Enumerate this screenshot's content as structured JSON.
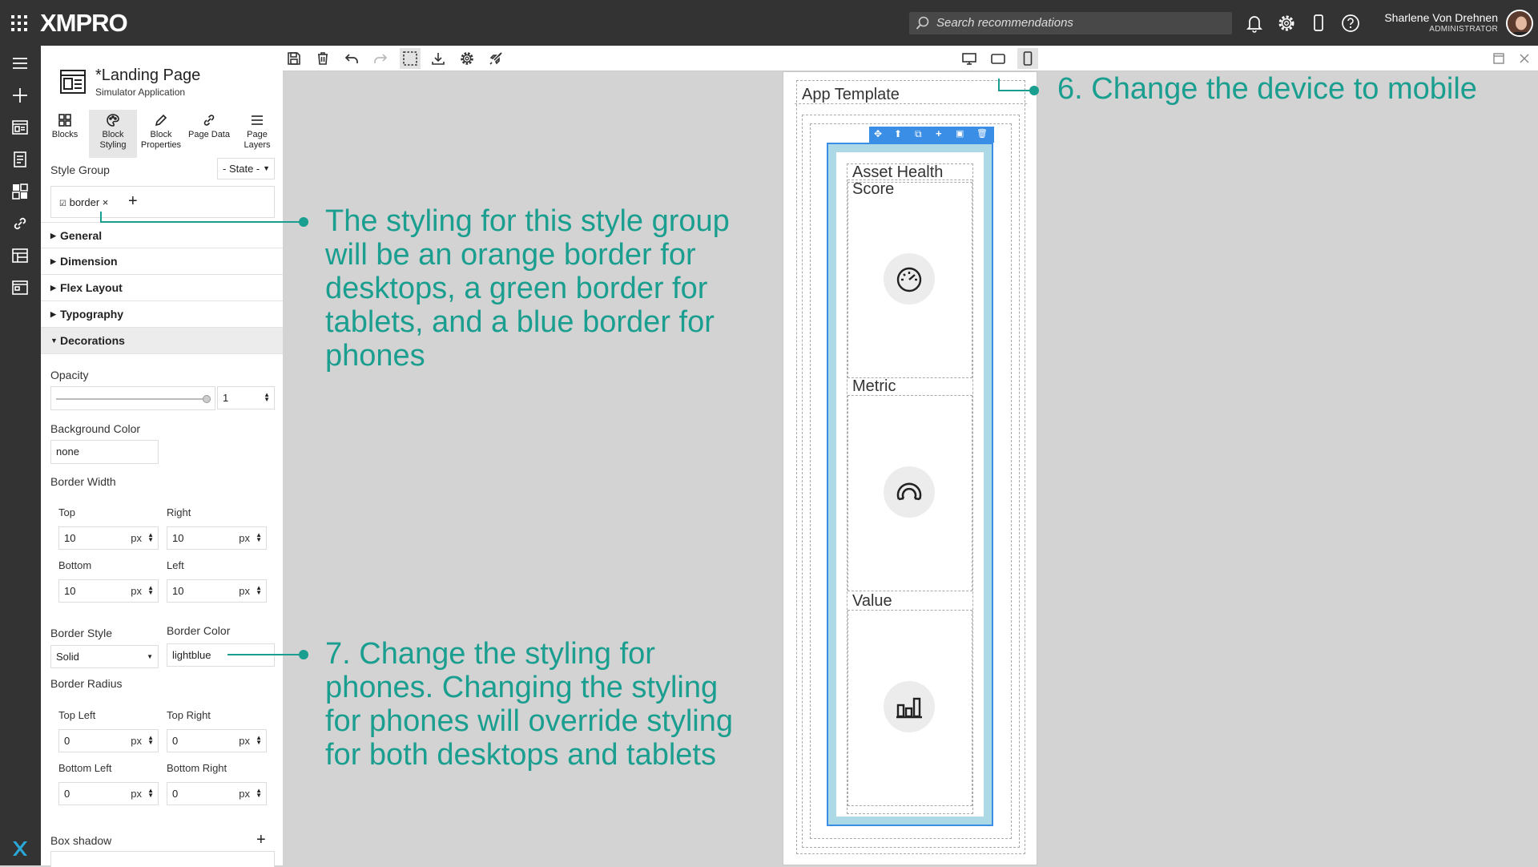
{
  "app": {
    "logo": "XMPRO",
    "search_placeholder": "Search recommendations",
    "user_name": "Sharlene Von Drehnen",
    "user_role": "ADMINISTRATOR"
  },
  "page": {
    "title": "*Landing Page",
    "subtitle": "Simulator Application"
  },
  "panel_tabs": [
    {
      "label": "Blocks"
    },
    {
      "label": "Block\nStyling"
    },
    {
      "label": "Block\nProperties"
    },
    {
      "label": "Page Data"
    },
    {
      "label": "Page\nLayers"
    }
  ],
  "style_group": {
    "label": "Style Group",
    "state": "- State -",
    "tag": "border",
    "tag_remove": "×",
    "add": "+"
  },
  "sections": {
    "general": "General",
    "dimension": "Dimension",
    "flex": "Flex Layout",
    "typography": "Typography",
    "decorations": "Decorations"
  },
  "decorations": {
    "opacity_label": "Opacity",
    "opacity_value": "1",
    "opacity_level": 1,
    "bg_label": "Background Color",
    "bg_value": "none",
    "bw_label": "Border Width",
    "top_label": "Top",
    "top_value": "10",
    "right_label": "Right",
    "right_value": "10",
    "bottom_label": "Bottom",
    "bottom_value": "10",
    "left_label": "Left",
    "left_value": "10",
    "unit": "px",
    "bstyle_label": "Border Style",
    "bstyle_value": "Solid",
    "bcolor_label": "Border Color",
    "bcolor_value": "lightblue",
    "radius_label": "Border Radius",
    "tl_label": "Top Left",
    "tl_value": "0",
    "tr_label": "Top Right",
    "tr_value": "0",
    "bl_label": "Bottom Left",
    "bl_value": "0",
    "br_label": "Bottom Right",
    "br_value": "0",
    "shadow_label": "Box shadow",
    "shadow_add": "+"
  },
  "canvas": {
    "app_template": "App Template",
    "blocks": [
      "Asset Health Score",
      "Metric",
      "Value"
    ]
  },
  "callouts": {
    "c6": "6. Change the device to mobile",
    "style_note": "The styling for this style group will be an orange border for desktops, a green border for tablets, and a blue border for phones",
    "c7": "7. Change the styling for phones. Changing the styling for phones will override styling for both desktops and tablets"
  },
  "colors": {
    "accent": "#1a9e8f",
    "selection": "#3a8ee6",
    "block_border": "#add8e6"
  }
}
